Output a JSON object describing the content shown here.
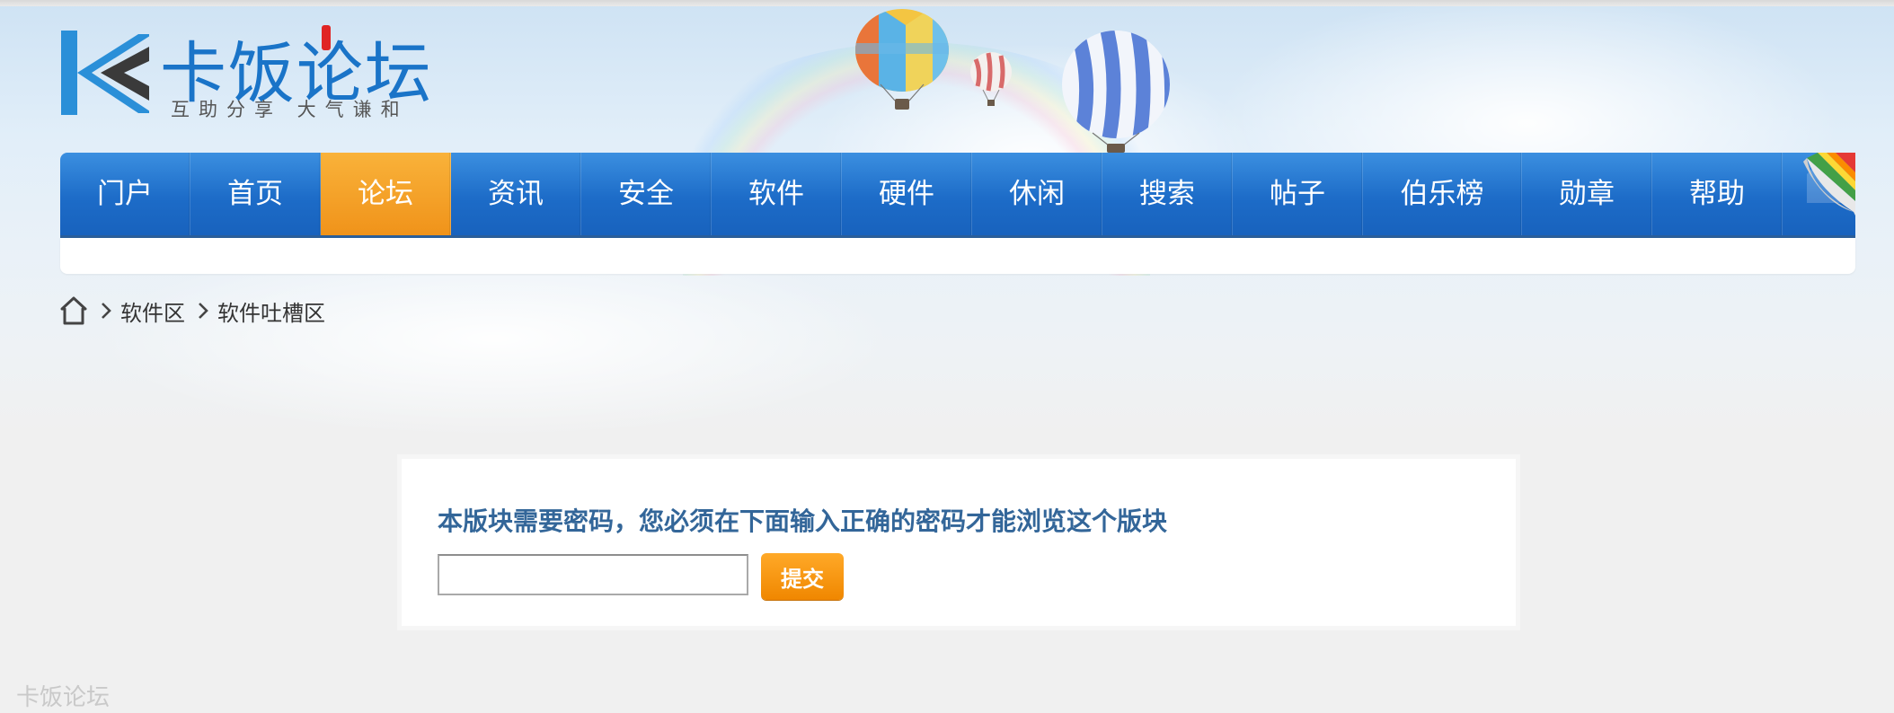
{
  "site": {
    "logo_title": "卡饭论坛",
    "logo_tagline": "互助分享 大气谦和"
  },
  "nav": {
    "items": [
      {
        "label": "门户"
      },
      {
        "label": "首页"
      },
      {
        "label": "论坛",
        "active": true
      },
      {
        "label": "资讯"
      },
      {
        "label": "安全"
      },
      {
        "label": "软件"
      },
      {
        "label": "硬件"
      },
      {
        "label": "休闲"
      },
      {
        "label": "搜索"
      },
      {
        "label": "帖子"
      },
      {
        "label": "伯乐榜"
      },
      {
        "label": "勋章"
      },
      {
        "label": "帮助"
      }
    ]
  },
  "breadcrumb": {
    "items": [
      "软件区",
      "软件吐槽区"
    ]
  },
  "password_form": {
    "message": "本版块需要密码，您必须在下面输入正确的密码才能浏览这个版块",
    "input_value": "",
    "submit_label": "提交"
  },
  "footer": {
    "watermark": "卡饭论坛"
  },
  "colors": {
    "nav_blue": "#1d6cc8",
    "nav_active_orange": "#f0931a",
    "message_blue": "#336699",
    "button_orange": "#f08700"
  },
  "icons": [
    "home-icon",
    "chevron-right-icon",
    "page-curl-icon",
    "hot-air-balloon"
  ]
}
